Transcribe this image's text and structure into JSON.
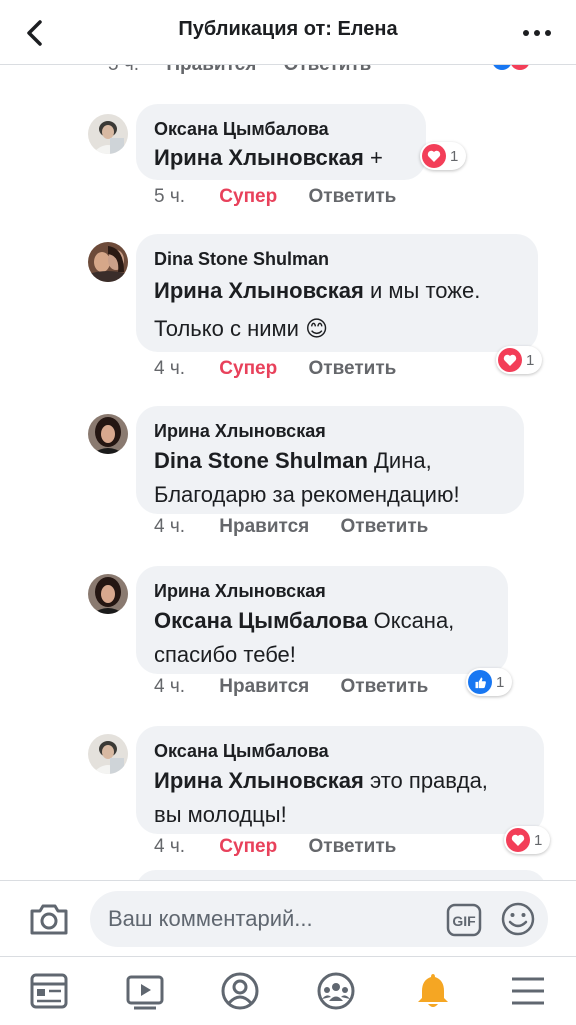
{
  "header": {
    "title": "Публикация от: Елена"
  },
  "partial": {
    "time": "5 ч.",
    "like": "Нравится",
    "reply": "Ответить"
  },
  "comments": [
    {
      "author": "Оксана Цымбалова",
      "mention": "Ирина Хлыновская",
      "text": " +",
      "time": "5 ч.",
      "reaction_label": "Супер",
      "reply_label": "Ответить",
      "reaction_type": "love",
      "reaction_count": "1"
    },
    {
      "author": "Dina Stone Shulman",
      "mention": "Ирина Хлыновская",
      "text": " и мы тоже.",
      "text2": "Только с ними 😊",
      "time": "4 ч.",
      "reaction_label": "Супер",
      "reply_label": "Ответить",
      "reaction_type": "love",
      "reaction_count": "1"
    },
    {
      "author": "Ирина Хлыновская",
      "mention": "Dina Stone Shulman",
      "text": "  Дина,",
      "text2": "Благодарю за рекомендацию!",
      "time": "4 ч.",
      "reaction_label": "Нравится",
      "reply_label": "Ответить"
    },
    {
      "author": "Ирина Хлыновская",
      "mention": "Оксана Цымбалова",
      "text": " Оксана,",
      "text2": "спасибо тебе!",
      "time": "4 ч.",
      "reaction_label": "Нравится",
      "reply_label": "Ответить",
      "reaction_type": "like",
      "reaction_count": "1"
    },
    {
      "author": "Оксана Цымбалова",
      "mention": "Ирина Хлыновская",
      "text": " это правда,",
      "text2": "вы молодцы!",
      "time": "4 ч.",
      "reaction_label": "Супер",
      "reply_label": "Ответить",
      "reaction_type": "love",
      "reaction_count": "1"
    }
  ],
  "composer": {
    "placeholder": "Ваш комментарий..."
  },
  "nav": [
    "news-feed",
    "watch",
    "profile",
    "groups",
    "notifications",
    "menu"
  ],
  "colors": {
    "accent": "#1877f2",
    "love": "#f33e58",
    "super_text": "#e8415b",
    "bubble": "#f0f2f5",
    "notifications": "#f5a623"
  }
}
